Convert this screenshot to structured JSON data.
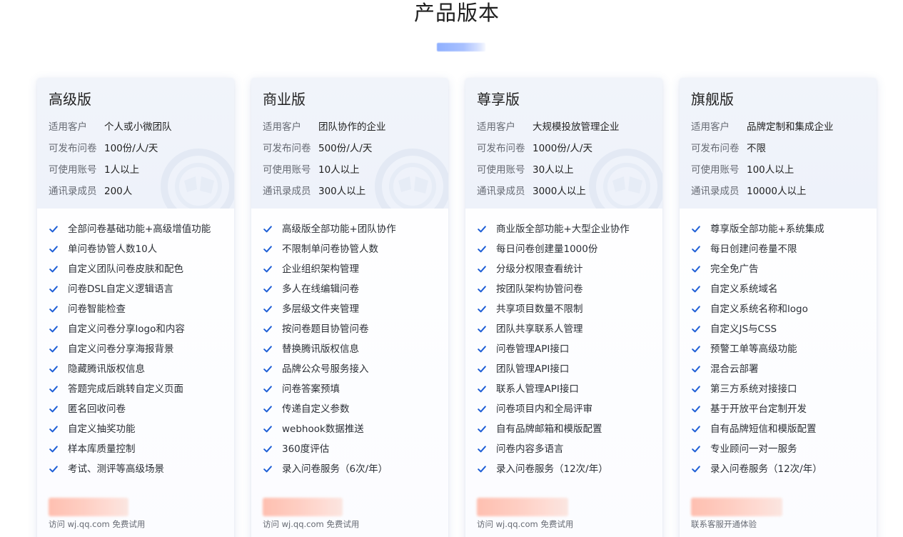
{
  "page": {
    "title": "产品版本"
  },
  "colors": {
    "accent": "#1f5fd6",
    "header_bg": "#eef2fa",
    "title_bar": "#a9c1ff",
    "price_blur": "#ffcabd"
  },
  "icons": {
    "feature_check": "check-icon",
    "header_watermark": "logo-watermark"
  },
  "plans": [
    {
      "name": "高级版",
      "info": [
        {
          "label": "适用客户",
          "value": "个人或小微团队"
        },
        {
          "label": "可发布问卷",
          "value": "100份/人/天"
        },
        {
          "label": "可使用账号",
          "value": "1人以上"
        },
        {
          "label": "通讯录成员",
          "value": "200人"
        }
      ],
      "features": [
        "全部问卷基础功能+高级增值功能",
        "单问卷协管人数10人",
        "自定义团队问卷皮肤和配色",
        "问卷DSL自定义逻辑语言",
        "问卷智能检查",
        "自定义问卷分享logo和内容",
        "自定义问卷分享海报背景",
        "隐藏腾讯版权信息",
        "答题完成后跳转自定义页面",
        "匿名回收问卷",
        "自定义抽奖功能",
        "样本库质量控制",
        "考试、测评等高级场景"
      ],
      "trial_note": "访问 wj.qq.com 免费试用"
    },
    {
      "name": "商业版",
      "info": [
        {
          "label": "适用客户",
          "value": "团队协作的企业"
        },
        {
          "label": "可发布问卷",
          "value": "500份/人/天"
        },
        {
          "label": "可使用账号",
          "value": "10人以上"
        },
        {
          "label": "通讯录成员",
          "value": "300人以上"
        }
      ],
      "features": [
        "高级版全部功能+团队协作",
        "不限制单问卷协管人数",
        "企业组织架构管理",
        "多人在线编辑问卷",
        "多层级文件夹管理",
        "按问卷题目协管问卷",
        "替换腾讯版权信息",
        "品牌公众号服务接入",
        "问卷答案预填",
        "传递自定义参数",
        "webhook数据推送",
        "360度评估",
        "录入问卷服务（6次/年）"
      ],
      "trial_note": "访问 wj.qq.com 免费试用"
    },
    {
      "name": "尊享版",
      "info": [
        {
          "label": "适用客户",
          "value": "大规模投放管理企业"
        },
        {
          "label": "可发布问卷",
          "value": "1000份/人/天"
        },
        {
          "label": "可使用账号",
          "value": "30人以上"
        },
        {
          "label": "通讯录成员",
          "value": "3000人以上"
        }
      ],
      "features": [
        "商业版全部功能+大型企业协作",
        "每日问卷创建量1000份",
        "分级分权限查看统计",
        "按团队架构协管问卷",
        "共享项目数量不限制",
        "团队共享联系人管理",
        "问卷管理API接口",
        "团队管理API接口",
        "联系人管理API接口",
        "问卷项目内和全局评审",
        "自有品牌邮箱和模版配置",
        "问卷内容多语言",
        "录入问卷服务（12次/年）"
      ],
      "trial_note": "访问 wj.qq.com 免费试用"
    },
    {
      "name": "旗舰版",
      "info": [
        {
          "label": "适用客户",
          "value": "品牌定制和集成企业"
        },
        {
          "label": "可发布问卷",
          "value": "不限"
        },
        {
          "label": "可使用账号",
          "value": "100人以上"
        },
        {
          "label": "通讯录成员",
          "value": "10000人以上"
        }
      ],
      "features": [
        "尊享版全部功能+系统集成",
        "每日创建问卷量不限",
        "完全免广告",
        "自定义系统域名",
        "自定义系统名称和logo",
        "自定义JS与CSS",
        "预警工单等高级功能",
        "混合云部署",
        "第三方系统对接接口",
        "基于开放平台定制开发",
        "自有品牌短信和模版配置",
        "专业顾问一对一服务",
        "录入问卷服务（12次/年）"
      ],
      "trial_note": "联系客服开通体验"
    }
  ]
}
